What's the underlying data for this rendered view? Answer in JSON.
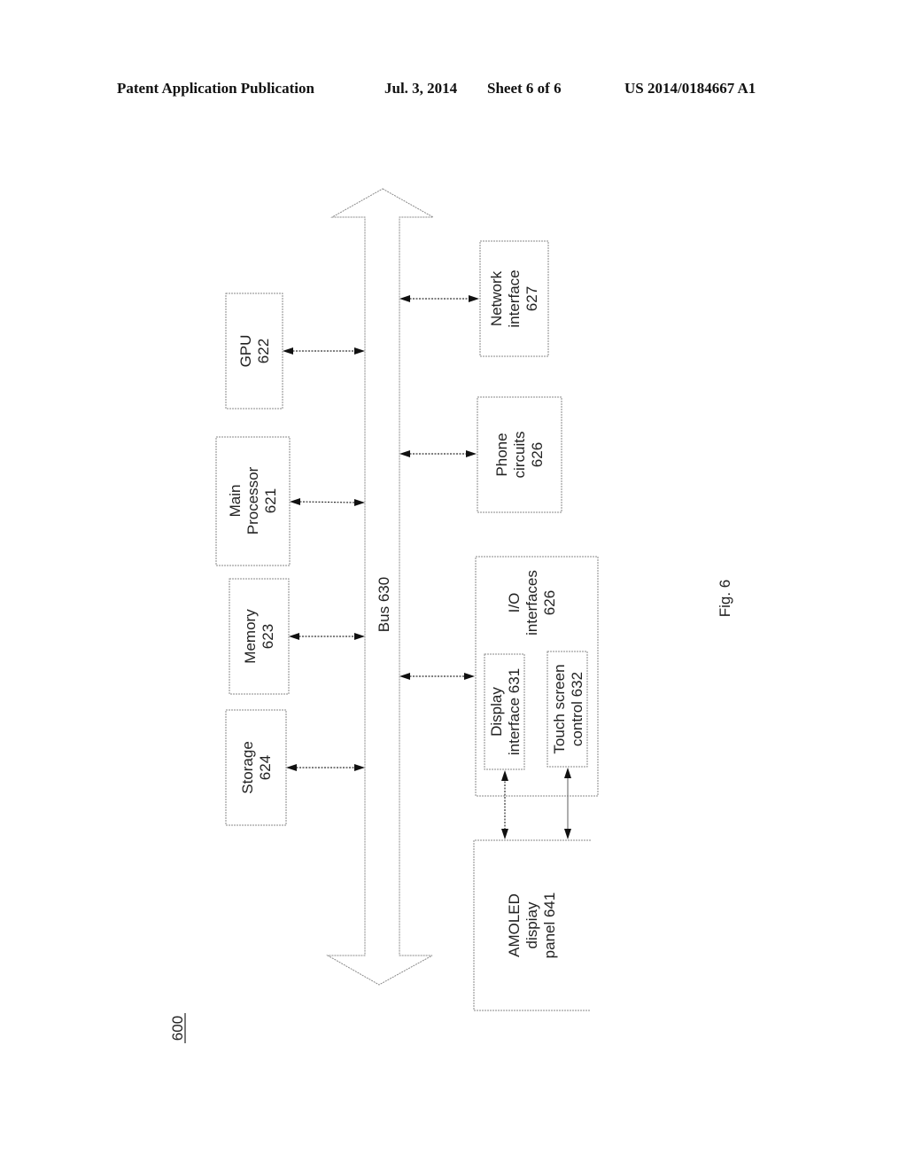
{
  "header": {
    "publication": "Patent Application Publication",
    "date": "Jul. 3, 2014",
    "sheet": "Sheet 6 of 6",
    "number": "US 2014/0184667 A1"
  },
  "figure": {
    "ref": "600",
    "caption": "Fig. 6",
    "bus": "Bus 630",
    "blocks": {
      "gpu": [
        "GPU",
        "622"
      ],
      "main_processor": [
        "Main",
        "Processor",
        "621"
      ],
      "memory": [
        "Memory",
        "623"
      ],
      "storage": [
        "Storage",
        "624"
      ],
      "network": [
        "Network",
        "interface",
        "627"
      ],
      "phone": [
        "Phone",
        "circuits",
        "626"
      ],
      "io": [
        "I/O",
        "interfaces",
        "626"
      ],
      "display_if": [
        "Display",
        "interface 631"
      ],
      "touch": [
        "Touch screen",
        "control 632"
      ],
      "amoled": [
        "AMOLED",
        "dispiay",
        "panel 641"
      ]
    }
  }
}
